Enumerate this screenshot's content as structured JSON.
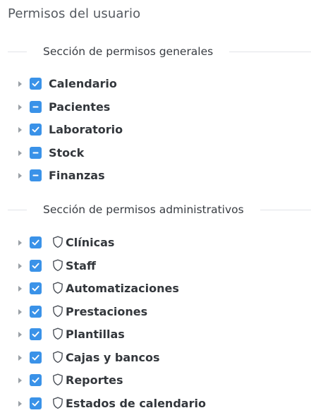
{
  "page": {
    "title": "Permisos del usuario"
  },
  "general": {
    "heading": "Sección de permisos generales",
    "items": [
      {
        "label": "Calendario",
        "state": "checked"
      },
      {
        "label": "Pacientes",
        "state": "indeterminate"
      },
      {
        "label": "Laboratorio",
        "state": "checked"
      },
      {
        "label": "Stock",
        "state": "indeterminate"
      },
      {
        "label": "Finanzas",
        "state": "indeterminate"
      }
    ]
  },
  "admin": {
    "heading": "Sección de permisos administrativos",
    "items": [
      {
        "label": "Clínicas",
        "state": "checked",
        "icon": "shield-icon"
      },
      {
        "label": "Staff",
        "state": "checked",
        "icon": "shield-icon"
      },
      {
        "label": "Automatizaciones",
        "state": "checked",
        "icon": "shield-icon"
      },
      {
        "label": "Prestaciones",
        "state": "checked",
        "icon": "shield-icon"
      },
      {
        "label": "Plantillas",
        "state": "checked",
        "icon": "shield-icon"
      },
      {
        "label": "Cajas y bancos",
        "state": "checked",
        "icon": "shield-icon"
      },
      {
        "label": "Reportes",
        "state": "checked",
        "icon": "shield-icon"
      },
      {
        "label": "Estados de calendario",
        "state": "checked",
        "icon": "shield-icon"
      }
    ]
  },
  "colors": {
    "checkbox": "#3a92e8",
    "caret": "#9aa0a6",
    "divider": "#e2e4e8"
  }
}
